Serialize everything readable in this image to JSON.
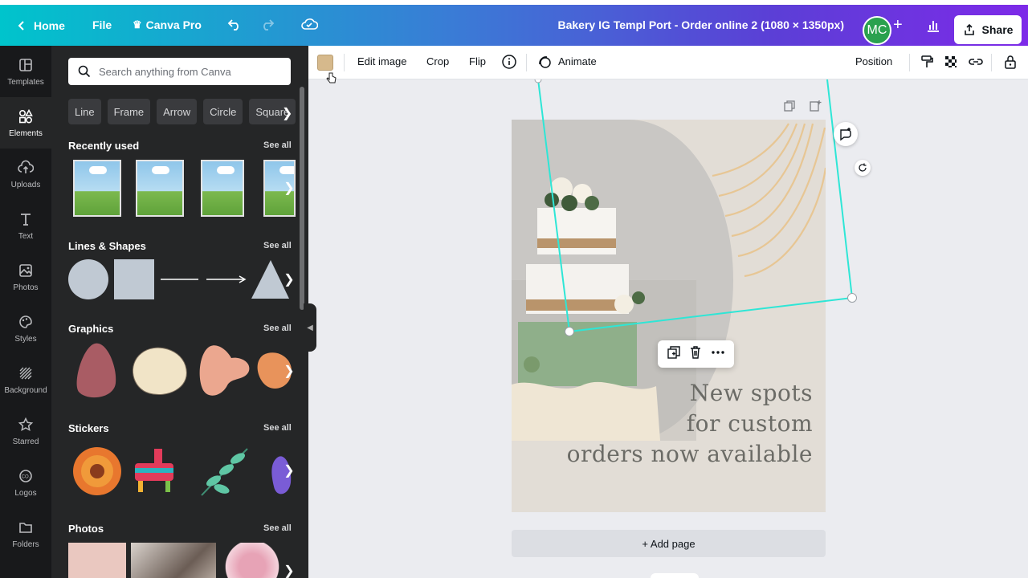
{
  "topbar": {
    "home_label": "Home",
    "file_label": "File",
    "pro_label": "Canva Pro",
    "document_title": "Bakery IG Templ Port - Order online 2 (1080 × 1350px)",
    "avatar_initials": "MC",
    "share_label": "Share"
  },
  "rail": {
    "items": [
      {
        "label": "Templates",
        "icon": "templates-icon"
      },
      {
        "label": "Elements",
        "icon": "elements-icon"
      },
      {
        "label": "Uploads",
        "icon": "uploads-icon"
      },
      {
        "label": "Text",
        "icon": "text-icon"
      },
      {
        "label": "Photos",
        "icon": "photos-icon"
      },
      {
        "label": "Styles",
        "icon": "styles-icon"
      },
      {
        "label": "Background",
        "icon": "background-icon"
      },
      {
        "label": "Starred",
        "icon": "star-icon"
      },
      {
        "label": "Logos",
        "icon": "logos-icon"
      },
      {
        "label": "Folders",
        "icon": "folders-icon"
      }
    ]
  },
  "panel": {
    "search_placeholder": "Search anything from Canva",
    "chips": [
      "Line",
      "Frame",
      "Arrow",
      "Circle",
      "Square"
    ],
    "sections": {
      "recently_used": "Recently used",
      "lines_shapes": "Lines & Shapes",
      "graphics": "Graphics",
      "stickers": "Stickers",
      "photos": "Photos"
    },
    "see_all": "See all"
  },
  "toolbar": {
    "swatch_color": "#d6b98c",
    "edit_image": "Edit image",
    "crop": "Crop",
    "flip": "Flip",
    "animate": "Animate",
    "position": "Position"
  },
  "canvas": {
    "headline_line1": "New spots",
    "headline_line2": "for custom",
    "headline_line3": "orders now available",
    "add_page": "+ Add page"
  },
  "colors": {
    "accent_teal": "#00c4cc",
    "accent_purple": "#7d2ae8",
    "selection": "#2ee6d6"
  }
}
